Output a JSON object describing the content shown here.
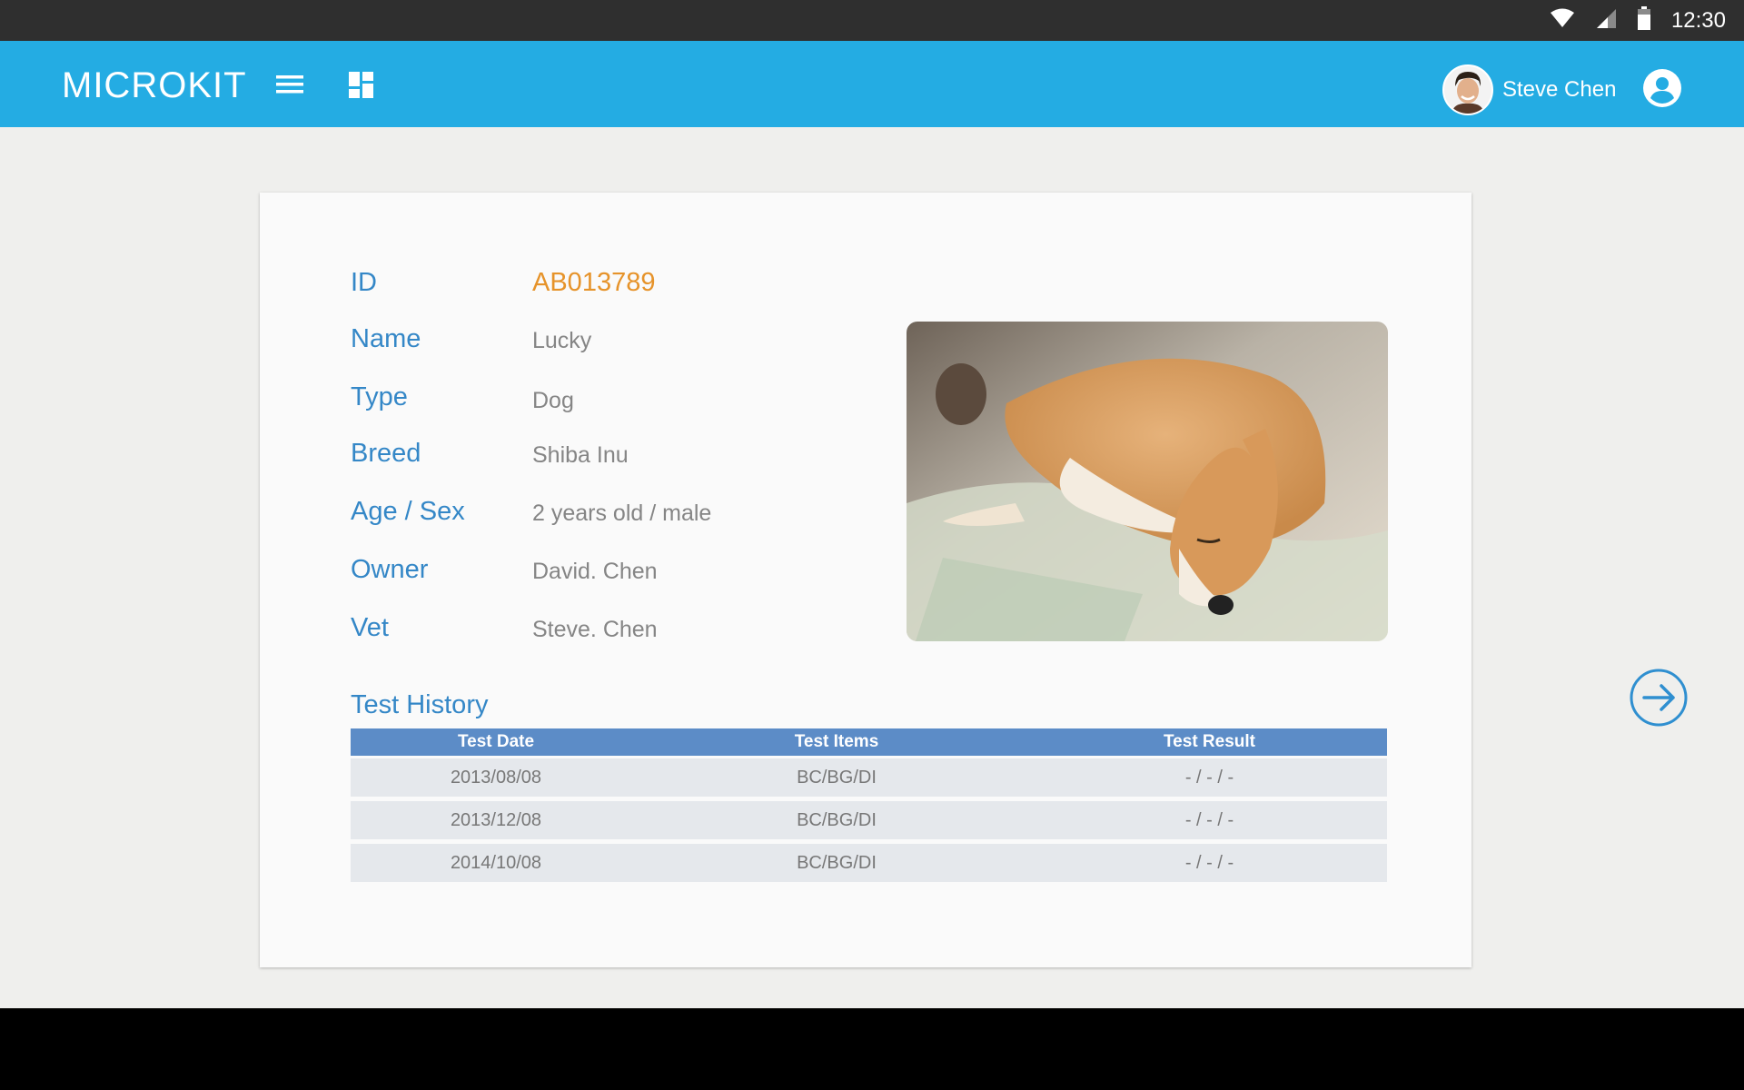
{
  "status_bar": {
    "time": "12:30",
    "icons": [
      "wifi-icon",
      "cell-signal-icon",
      "battery-icon"
    ]
  },
  "app_bar": {
    "brand": "MICROKIT",
    "menu_icon": "hamburger-menu-icon",
    "dashboard_icon": "dashboard-icon",
    "user_name": "Steve Chen",
    "account_icon": "account-circle-icon",
    "color": "#24ace3"
  },
  "pet": {
    "id_label": "ID",
    "id_value": "AB013789",
    "fields": [
      {
        "label": "Name",
        "value": "Lucky"
      },
      {
        "label": "Type",
        "value": "Dog"
      },
      {
        "label": "Breed",
        "value": "Shiba Inu"
      },
      {
        "label": "Age / Sex",
        "value": "2 years old / male"
      },
      {
        "label": "Owner",
        "value": "David. Chen"
      },
      {
        "label": "Vet",
        "value": "Steve. Chen"
      }
    ],
    "photo": "sleeping-shiba-inu-photo"
  },
  "test_history": {
    "title": "Test History",
    "columns": [
      "Test Date",
      "Test Items",
      "Test Result"
    ],
    "rows": [
      [
        "2013/08/08",
        "BC/BG/DI",
        "- / - / -"
      ],
      [
        "2013/12/08",
        "BC/BG/DI",
        "- / - / -"
      ],
      [
        "2014/10/08",
        "BC/BG/DI",
        "- / - / -"
      ]
    ]
  },
  "navigation": {
    "next_icon": "arrow-right-circle-icon"
  },
  "colors": {
    "label": "#3487c7",
    "id_accent": "#e6932a",
    "table_header": "#5c8cc7"
  }
}
